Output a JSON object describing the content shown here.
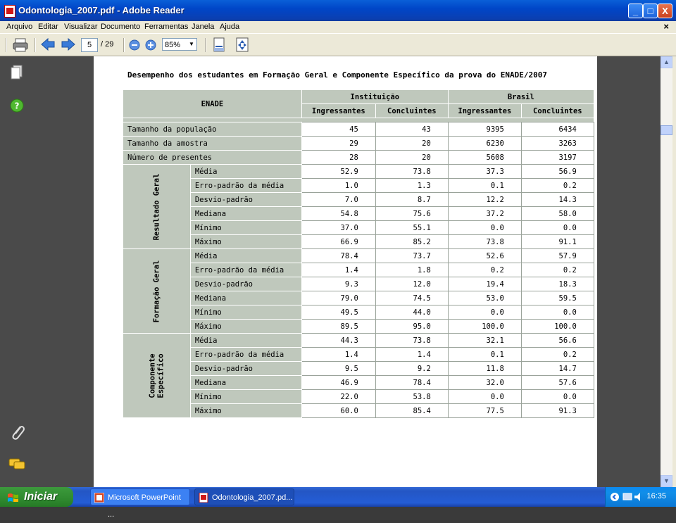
{
  "window": {
    "title": "Odontologia_2007.pdf - Adobe Reader",
    "minimize": "_",
    "maximize": "□",
    "close": "X"
  },
  "menu": {
    "items": [
      "Arquivo",
      "Editar",
      "Visualizar",
      "Documento",
      "Ferramentas",
      "Janela",
      "Ajuda"
    ],
    "close_doc": "×"
  },
  "toolbar": {
    "current_page": "5",
    "total_pages": "/ 29",
    "zoom": "85%"
  },
  "document": {
    "title": "Desempenho dos estudantes em Formação Geral e Componente Específico da prova do ENADE/2007",
    "table": {
      "corner": "ENADE",
      "group_headers": [
        "Instituição",
        "Brasil"
      ],
      "col_headers": [
        "Ingressantes",
        "Concluintes",
        "Ingressantes",
        "Concluintes"
      ],
      "top_rows": [
        {
          "label": "Tamanho da população",
          "values": [
            "45",
            "43",
            "9395",
            "6434"
          ]
        },
        {
          "label": "Tamanho da amostra",
          "values": [
            "29",
            "20",
            "6230",
            "3263"
          ]
        },
        {
          "label": "Número de presentes",
          "values": [
            "28",
            "20",
            "5608",
            "3197"
          ]
        }
      ],
      "sections": [
        {
          "name": "Resultado Geral",
          "rows": [
            {
              "label": "Média",
              "values": [
                "52.9",
                "73.8",
                "37.3",
                "56.9"
              ]
            },
            {
              "label": "Erro-padrão da média",
              "values": [
                "1.0",
                "1.3",
                "0.1",
                "0.2"
              ]
            },
            {
              "label": "Desvio-padrão",
              "values": [
                "7.0",
                "8.7",
                "12.2",
                "14.3"
              ]
            },
            {
              "label": "Mediana",
              "values": [
                "54.8",
                "75.6",
                "37.2",
                "58.0"
              ]
            },
            {
              "label": "Mínimo",
              "values": [
                "37.0",
                "55.1",
                "0.0",
                "0.0"
              ]
            },
            {
              "label": "Máximo",
              "values": [
                "66.9",
                "85.2",
                "73.8",
                "91.1"
              ]
            }
          ]
        },
        {
          "name": "Formação Geral",
          "rows": [
            {
              "label": "Média",
              "values": [
                "78.4",
                "73.7",
                "52.6",
                "57.9"
              ]
            },
            {
              "label": "Erro-padrão da média",
              "values": [
                "1.4",
                "1.8",
                "0.2",
                "0.2"
              ]
            },
            {
              "label": "Desvio-padrão",
              "values": [
                "9.3",
                "12.0",
                "19.4",
                "18.3"
              ]
            },
            {
              "label": "Mediana",
              "values": [
                "79.0",
                "74.5",
                "53.0",
                "59.5"
              ]
            },
            {
              "label": "Mínimo",
              "values": [
                "49.5",
                "44.0",
                "0.0",
                "0.0"
              ]
            },
            {
              "label": "Máximo",
              "values": [
                "89.5",
                "95.0",
                "100.0",
                "100.0"
              ]
            }
          ]
        },
        {
          "name_line1": "Componente",
          "name_line2": "Específico",
          "rows": [
            {
              "label": "Média",
              "values": [
                "44.3",
                "73.8",
                "32.1",
                "56.6"
              ]
            },
            {
              "label": "Erro-padrão da média",
              "values": [
                "1.4",
                "1.4",
                "0.1",
                "0.2"
              ]
            },
            {
              "label": "Desvio-padrão",
              "values": [
                "9.5",
                "9.2",
                "11.8",
                "14.7"
              ]
            },
            {
              "label": "Mediana",
              "values": [
                "46.9",
                "78.4",
                "32.0",
                "57.6"
              ]
            },
            {
              "label": "Mínimo",
              "values": [
                "22.0",
                "53.8",
                "0.0",
                "0.0"
              ]
            },
            {
              "label": "Máximo",
              "values": [
                "60.0",
                "85.4",
                "77.5",
                "91.3"
              ]
            }
          ]
        }
      ]
    }
  },
  "taskbar": {
    "start": "Iniciar",
    "tasks": [
      "Microsoft PowerPoint ...",
      "Odontologia_2007.pd..."
    ],
    "clock": "16:35"
  }
}
